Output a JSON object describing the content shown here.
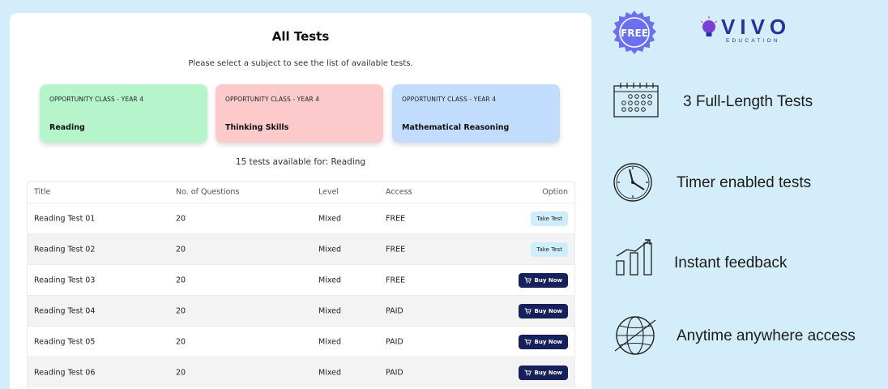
{
  "main": {
    "title": "All Tests",
    "subtitle": "Please select a subject to see the list of available tests.",
    "subjects": [
      {
        "class_label": "OPPORTUNITY CLASS - YEAR 4",
        "name": "Reading",
        "color": "#b6f4cc"
      },
      {
        "class_label": "OPPORTUNITY CLASS - YEAR 4",
        "name": "Thinking Skills",
        "color": "#fccaca"
      },
      {
        "class_label": "OPPORTUNITY CLASS - YEAR 4",
        "name": "Mathematical Reasoning",
        "color": "#c2dcfd"
      }
    ],
    "tests_count": "15 tests available for: Reading",
    "table": {
      "headers": {
        "title": "Title",
        "questions": "No. of Questions",
        "level": "Level",
        "access": "Access",
        "option": "Option"
      },
      "rows": [
        {
          "title": "Reading Test 01",
          "questions": "20",
          "level": "Mixed",
          "access": "FREE",
          "option": "Take Test",
          "option_type": "take"
        },
        {
          "title": "Reading Test 02",
          "questions": "20",
          "level": "Mixed",
          "access": "FREE",
          "option": "Take Test",
          "option_type": "take"
        },
        {
          "title": "Reading Test 03",
          "questions": "20",
          "level": "Mixed",
          "access": "FREE",
          "option": "Buy Now",
          "option_type": "buy"
        },
        {
          "title": "Reading Test 04",
          "questions": "20",
          "level": "Mixed",
          "access": "PAID",
          "option": "Buy Now",
          "option_type": "buy"
        },
        {
          "title": "Reading Test 05",
          "questions": "20",
          "level": "Mixed",
          "access": "PAID",
          "option": "Buy Now",
          "option_type": "buy"
        },
        {
          "title": "Reading Test 06",
          "questions": "20",
          "level": "Mixed",
          "access": "PAID",
          "option": "Buy Now",
          "option_type": "buy"
        }
      ]
    }
  },
  "promo": {
    "free_badge": "FREE",
    "logo_word": "VIVO",
    "logo_sub": "EDUCATION",
    "features": [
      {
        "label": "3 Full-Length Tests",
        "icon": "calendar-icon"
      },
      {
        "label": "Timer enabled tests",
        "icon": "clock-icon"
      },
      {
        "label": "Instant feedback",
        "icon": "bar-chart-icon"
      },
      {
        "label": "Anytime anywhere access",
        "icon": "globe-icon"
      }
    ]
  },
  "colors": {
    "background": "#d3eefa",
    "buy_button": "#16205a",
    "take_button": "#cfeefb",
    "badge": "#6b70f0",
    "logo": "#2a2f9c"
  }
}
